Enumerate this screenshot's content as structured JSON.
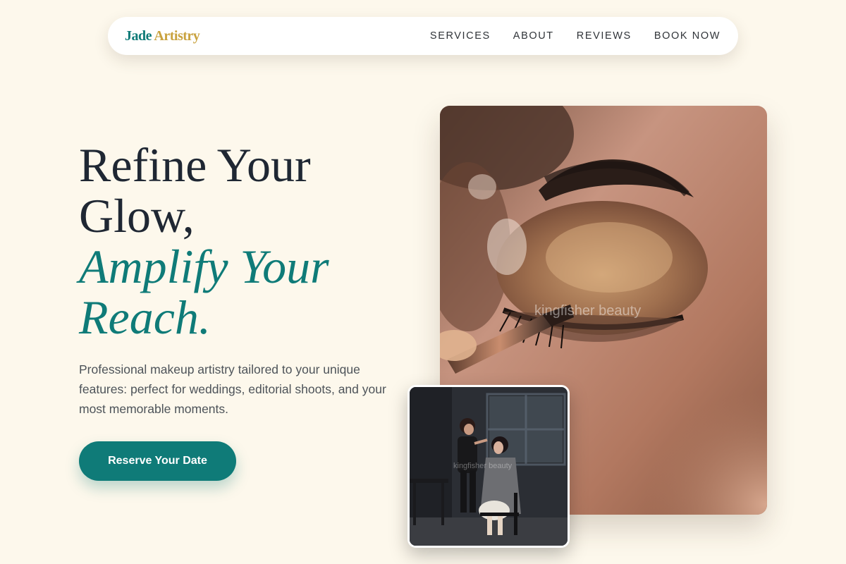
{
  "brand": {
    "part1": "Jade",
    "part2": "Artistry"
  },
  "nav": {
    "items": [
      {
        "label": "SERVICES"
      },
      {
        "label": "ABOUT"
      },
      {
        "label": "REVIEWS"
      },
      {
        "label": "BOOK NOW"
      }
    ]
  },
  "hero": {
    "headline_line1": "Refine Your Glow,",
    "headline_line2": "Amplify Your Reach.",
    "lead": "Professional makeup artistry tailored to your unique features: perfect for weddings, editorial shoots, and your most memorable moments.",
    "cta_label": "Reserve Your Date"
  },
  "images": {
    "main": {
      "watermark": "kingfisher beauty"
    },
    "secondary": {
      "watermark": "kingfisher beauty"
    }
  },
  "colors": {
    "background": "#fdf8ec",
    "accent_teal": "#0f7b78",
    "accent_gold": "#c9a23e",
    "text_dark": "#1f2733"
  }
}
